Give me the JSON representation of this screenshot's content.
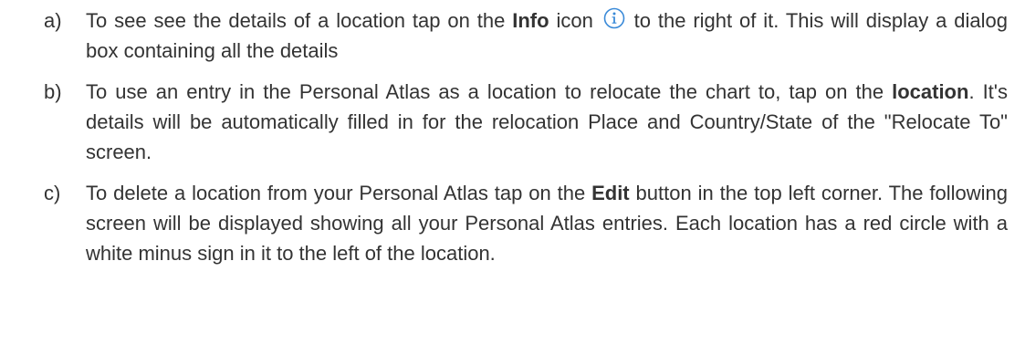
{
  "items": [
    {
      "marker": "a)",
      "seg1": "To see see the details of a location tap on the ",
      "bold1": "Info",
      "seg2": " icon ",
      "icon": "info-circle-icon",
      "seg3": " to the right of it. This will display a dialog box containing all the details"
    },
    {
      "marker": "b)",
      "seg1": "To use an entry in the Personal Atlas as a location to relocate the chart to, tap on the ",
      "bold1": "location",
      "seg2": ". It's details will be automatically filled in for the relocation Place and Country/State of the \"Relocate To\" screen."
    },
    {
      "marker": "c)",
      "seg1": "To delete a location from your Personal Atlas tap on the ",
      "bold1": "Edit",
      "seg2": " button in the top left corner. The following screen will be displayed showing all your Personal Atlas entries. Each location has a red circle with a white minus sign in it to the left of the location."
    }
  ],
  "colors": {
    "text": "#333333",
    "icon_blue": "#3a8ad8"
  }
}
